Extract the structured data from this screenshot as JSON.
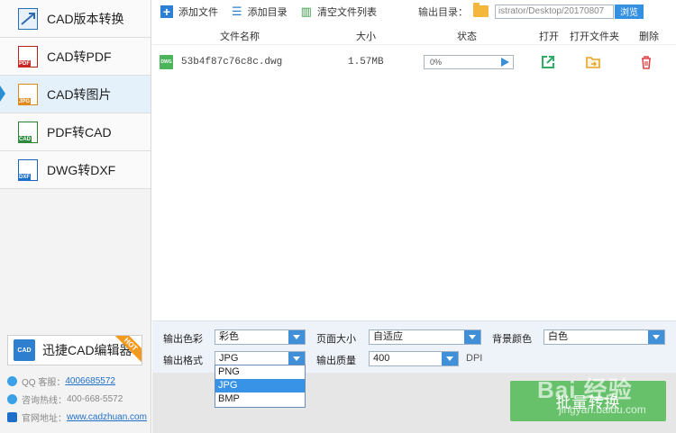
{
  "sidebar": {
    "items": [
      {
        "label": "CAD版本转换",
        "icon": "cad-version-icon",
        "tag": "",
        "active": false
      },
      {
        "label": "CAD转PDF",
        "icon": "cad-to-pdf-icon",
        "tag": "PDF",
        "active": false
      },
      {
        "label": "CAD转图片",
        "icon": "cad-to-image-icon",
        "tag": "JPG",
        "active": true
      },
      {
        "label": "PDF转CAD",
        "icon": "pdf-to-cad-icon",
        "tag": "CAD",
        "active": false
      },
      {
        "label": "DWG转DXF",
        "icon": "dwg-to-dxf-icon",
        "tag": "DXF",
        "active": false
      }
    ],
    "editor_button": {
      "label": "迅捷CAD编辑器",
      "badge": "HOT",
      "icon_text": "CAD"
    },
    "contacts": {
      "qq_label": "QQ 客服：",
      "qq_value": "4006685572",
      "phone_label": "咨询热线：",
      "phone_value": "400-668-5572",
      "site_label": "官网地址：",
      "site_value": "www.cadzhuan.com"
    }
  },
  "toolbar": {
    "add_file": "添加文件",
    "add_folder": "添加目录",
    "clear_list": "清空文件列表",
    "output_dir_label": "输出目录：",
    "output_path": "istrator/Desktop/20170807",
    "browse": "浏览"
  },
  "table": {
    "headers": {
      "name": "文件名称",
      "size": "大小",
      "status": "状态",
      "open": "打开",
      "open_folder": "打开文件夹",
      "delete": "删除"
    },
    "rows": [
      {
        "name": "53b4f87c76c8c.dwg",
        "size": "1.57MB",
        "progress": "0%",
        "file_type": "DWG"
      }
    ]
  },
  "options": {
    "color_label": "输出色彩",
    "color_value": "彩色",
    "page_size_label": "页面大小",
    "page_size_value": "自适应",
    "bg_color_label": "背景颜色",
    "bg_color_value": "白色",
    "format_label": "输出格式",
    "format_value": "JPG",
    "quality_label": "输出质量",
    "quality_value": "400",
    "quality_unit": "DPI",
    "format_options": [
      "PNG",
      "JPG",
      "BMP"
    ],
    "format_selected_index": 1
  },
  "convert_button": "批量转换",
  "watermark": {
    "main": "Bai 经验",
    "sub": "jingyan.baidu.com"
  },
  "colors": {
    "accent": "#3490e0",
    "convert": "#67c16b",
    "active_bg": "#e4f1fb",
    "hot": "#f39a1e"
  }
}
